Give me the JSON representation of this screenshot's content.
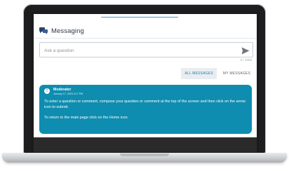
{
  "header": {
    "title": "Messaging",
    "icon": "chat-bubbles-icon"
  },
  "search": {
    "placeholder": "Ask a question",
    "value": "",
    "send_icon": "send-arrow-icon"
  },
  "counter": "0 / 1000",
  "tabs": [
    {
      "label": "ALL MESSAGES",
      "active": true
    },
    {
      "label": "MY MESSAGES",
      "active": false
    }
  ],
  "message": {
    "author": "Moderator",
    "time": "January 17, 2023 4:17 PM",
    "icon": "info-icon",
    "body": [
      "To enter a question or comment, compose your question or comment at the top of the screen and then click on the arrow icon to submit.",
      "To return to the main page click on the Home icon."
    ]
  },
  "colors": {
    "accent": "#0e8db0",
    "tab_active": "#1e7fae"
  }
}
